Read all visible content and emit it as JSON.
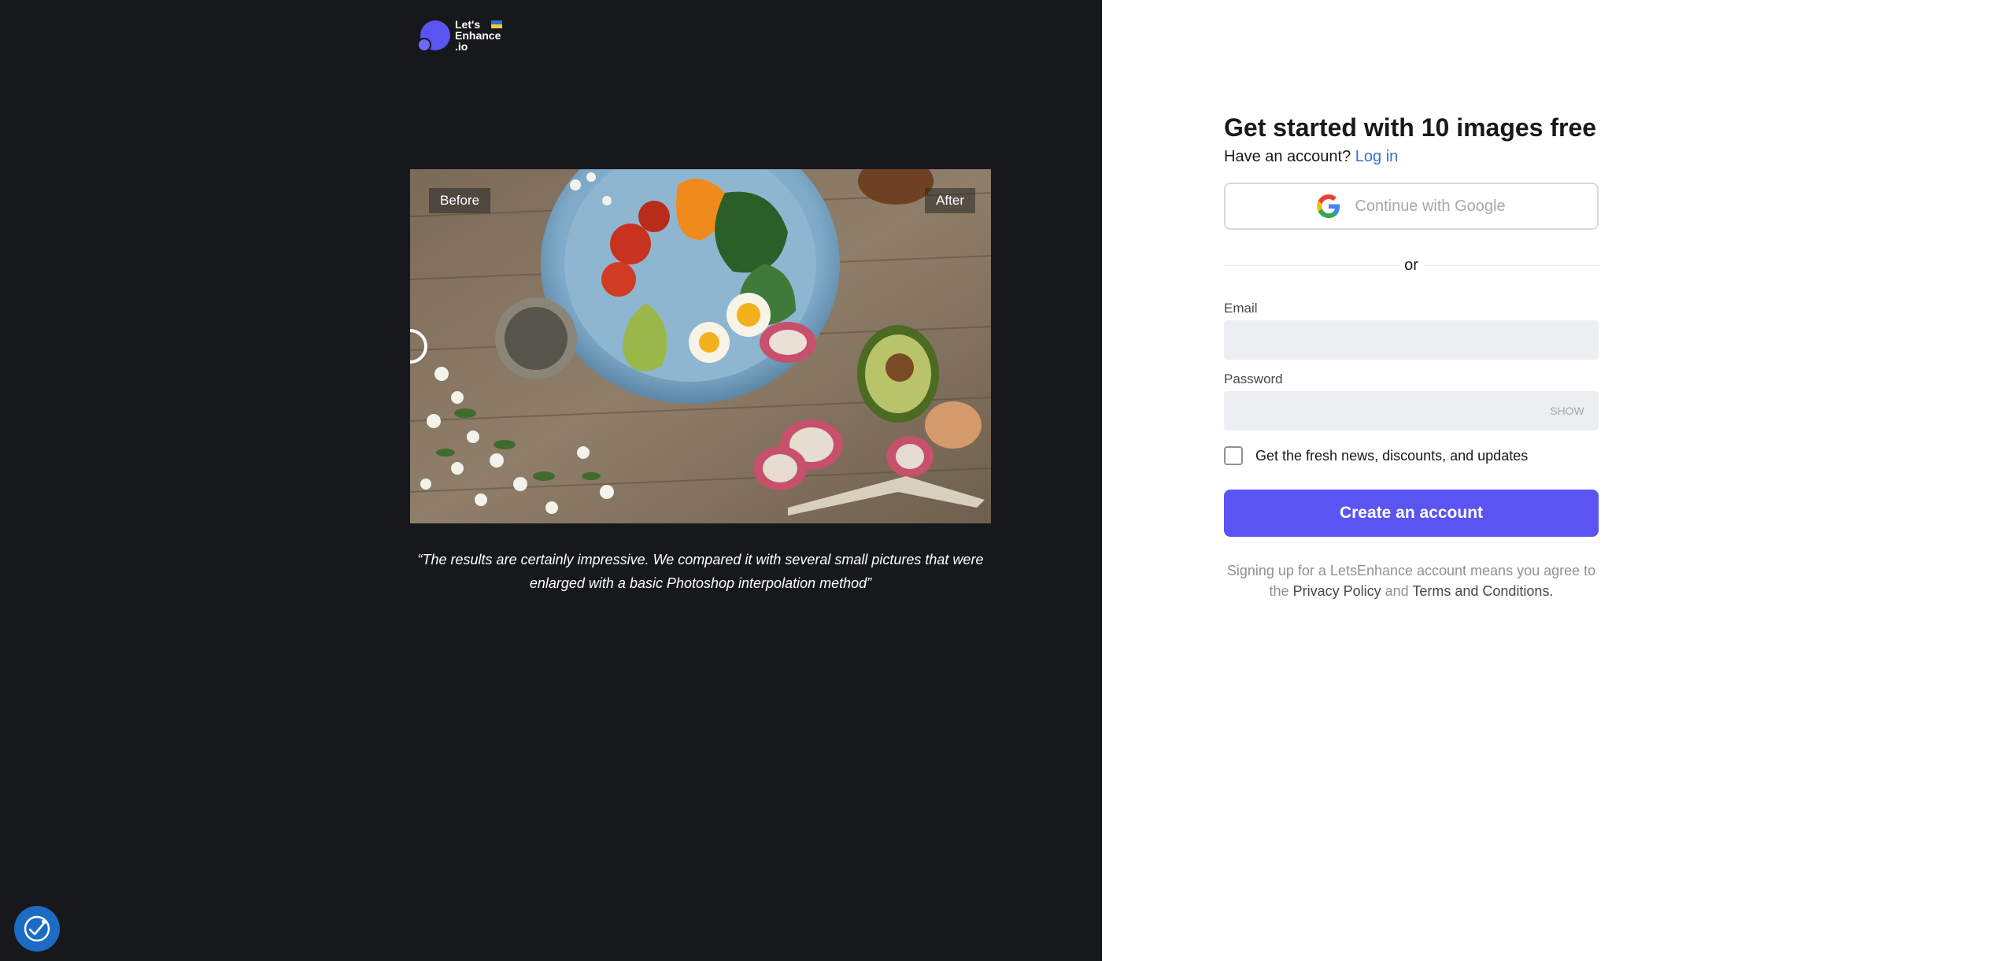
{
  "logo": {
    "line1": "Let's",
    "line2": "Enhance",
    "line3": ".io"
  },
  "showcase": {
    "before_label": "Before",
    "after_label": "After",
    "quote": "“The results are certainly impressive. We compared it with several small pictures that were enlarged with a basic Photoshop interpolation method”"
  },
  "signup": {
    "title": "Get started with 10 images free",
    "have_account_text": "Have an account?",
    "login_link": "Log in",
    "google_button": "Continue with Google",
    "divider_text": "or",
    "email_label": "Email",
    "email_value": "",
    "password_label": "Password",
    "password_value": "",
    "show_password": "SHOW",
    "newsletter_label": "Get the fresh news, discounts, and updates",
    "newsletter_checked": false,
    "create_button": "Create an account",
    "terms_prefix": "Signing up for a LetsEnhance account means you agree to the",
    "privacy_link": "Privacy Policy",
    "terms_and": "and",
    "terms_link": "Terms and Conditions",
    "terms_suffix": "."
  },
  "colors": {
    "left_bg": "#17181b",
    "brand": "#5a54f2",
    "link": "#2f74d8",
    "accessibility": "#1c6bc4"
  },
  "icons": {
    "google": "google-icon",
    "accessibility": "accessibility-icon"
  }
}
